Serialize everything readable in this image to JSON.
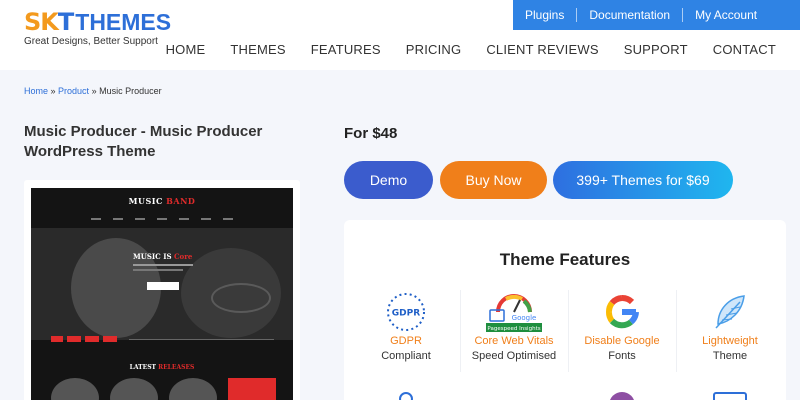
{
  "brand": {
    "logo_sk": "SK",
    "logo_t": "T",
    "logo_themes": "THEMES",
    "tagline": "Great Designs, Better Support"
  },
  "topbar": {
    "links": [
      "Plugins",
      "Documentation",
      "My Account"
    ]
  },
  "nav": {
    "items": [
      "HOME",
      "THEMES",
      "FEATURES",
      "PRICING",
      "CLIENT REVIEWS",
      "SUPPORT",
      "CONTACT"
    ]
  },
  "breadcrumb": {
    "home": "Home",
    "sep": " » ",
    "product": "Product",
    "current": "Music Producer"
  },
  "product": {
    "title": "Music Producer - Music Producer WordPress Theme",
    "price": "For $48"
  },
  "preview": {
    "logo_a": "MUSIC ",
    "logo_b": "BAND",
    "headline_a": "MUSIC IS ",
    "headline_b": "Core",
    "latest_a": "LATEST ",
    "latest_b": "RELEASES"
  },
  "buttons": {
    "demo": "Demo",
    "buy": "Buy Now",
    "bundle": "399+ Themes for $69"
  },
  "features": {
    "title": "Theme Features",
    "items": [
      {
        "icon": "gdpr-icon",
        "label1": "GDPR",
        "label2": "Compliant"
      },
      {
        "icon": "core-web-vitals-icon",
        "label1": "Core Web Vitals",
        "label2": "Speed Optimised"
      },
      {
        "icon": "google-icon",
        "label1": "Disable Google",
        "label2": "Fonts"
      },
      {
        "icon": "feather-icon",
        "label1": "Lightweight",
        "label2": "Theme"
      }
    ],
    "gdpr_badge": "GDPR",
    "google_badge": "Google",
    "pagespeed_badge": "Pagespeed Insights"
  },
  "colors": {
    "accent_orange": "#f07f1a",
    "accent_blue": "#2f83e4",
    "demo_blue": "#3b5ccd"
  }
}
